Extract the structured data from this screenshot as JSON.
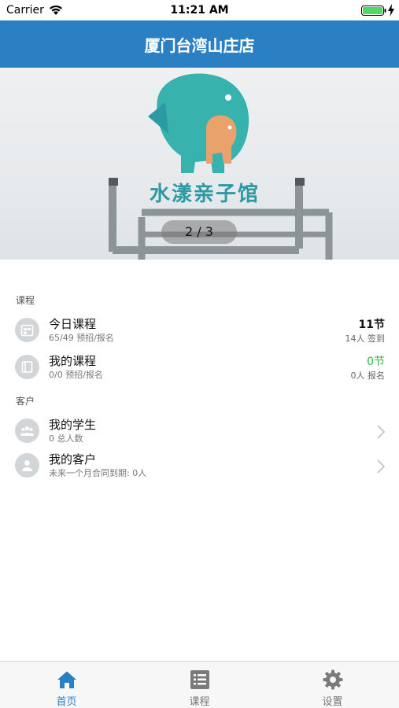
{
  "status_bar": {
    "carrier": "Carrier",
    "time": "11:21 AM"
  },
  "header": {
    "title": "厦门台湾山庄店"
  },
  "banner": {
    "logo_text": "水漾亲子馆",
    "counter": "2 / 3"
  },
  "sections": [
    {
      "title": "课程",
      "rows": [
        {
          "title": "今日课程",
          "subtitle": "65/49 预招/报名",
          "right_value": "11节",
          "right_note": "14人 签到",
          "icon": "calendar-icon"
        },
        {
          "title": "我的课程",
          "subtitle": "0/0 预招/报名",
          "right_value": "0节",
          "right_note": "0人 报名",
          "icon": "book-icon"
        }
      ]
    },
    {
      "title": "客户",
      "rows": [
        {
          "title": "我的学生",
          "subtitle": "0 总人数",
          "icon": "group-icon"
        },
        {
          "title": "我的客户",
          "subtitle": "未来一个月合同到期: 0人",
          "icon": "person-icon"
        }
      ]
    }
  ],
  "tabs": [
    {
      "label": "首页",
      "icon": "home-icon"
    },
    {
      "label": "课程",
      "icon": "list-icon"
    },
    {
      "label": "设置",
      "icon": "gear-icon"
    }
  ],
  "colors": {
    "brand": "#2b80c4",
    "green": "#2db84d",
    "teal": "#2a9aa3",
    "orange": "#e5a070"
  }
}
